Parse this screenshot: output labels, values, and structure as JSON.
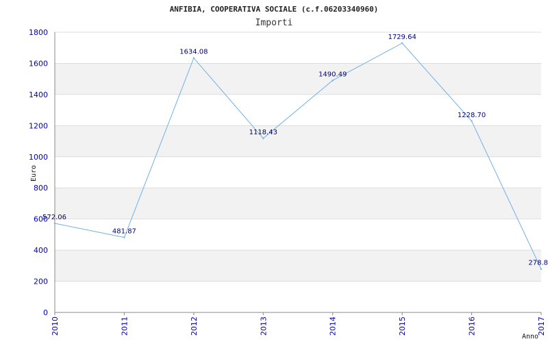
{
  "chart_data": {
    "type": "line",
    "title": "ANFIBIA, COOPERATIVA SOCIALE (c.f.06203340960)",
    "subtitle": "Importi",
    "xlabel": "Anno",
    "ylabel": "Euro",
    "x": [
      "2010",
      "2011",
      "2012",
      "2013",
      "2014",
      "2015",
      "2016",
      "2017"
    ],
    "series": [
      {
        "values": [
          572.06,
          481.87,
          1634.08,
          1118.43,
          1490.49,
          1729.64,
          1228.7,
          278.8
        ],
        "labels": [
          "572.06",
          "481.87",
          "1634.08",
          "1118.43",
          "1490.49",
          "1729.64",
          "1228.70",
          "278.8"
        ]
      }
    ],
    "ylim": [
      0,
      1800
    ],
    "yticks": [
      "0",
      "200",
      "400",
      "600",
      "800",
      "1000",
      "1200",
      "1400",
      "1600",
      "1800"
    ],
    "grid": true,
    "colors": {
      "line": "#6fb0e8",
      "band": "#f2f2f2",
      "gridline": "#dddddd",
      "tick_text": "#0000aa",
      "data_label": "#000080"
    }
  }
}
